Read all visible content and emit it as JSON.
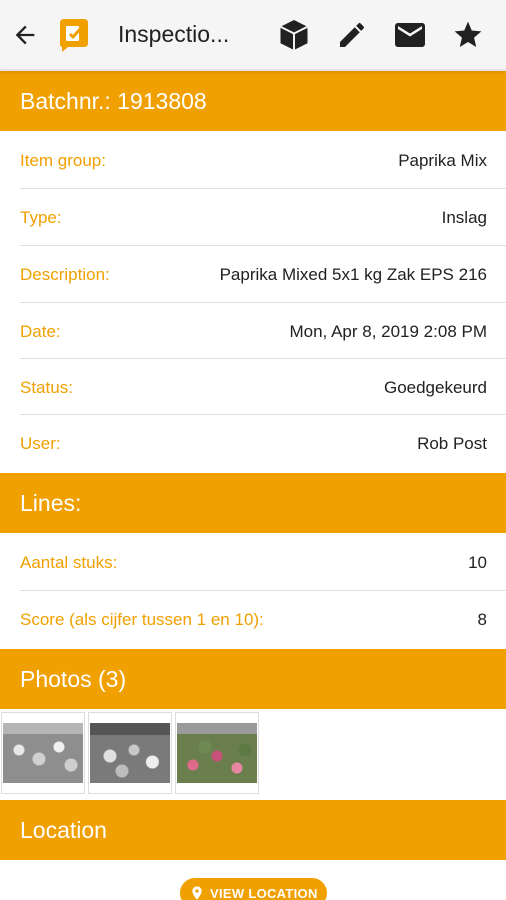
{
  "appbar": {
    "title": "Inspectio...",
    "back_icon": "arrow-left-icon",
    "logo_icon": "app-logo-icon",
    "actions": [
      "cube-icon",
      "pencil-icon",
      "mail-icon",
      "star-icon"
    ]
  },
  "batch_header": "Batchnr.: 1913808",
  "details": [
    {
      "label": "Item group:",
      "value": "Paprika Mix"
    },
    {
      "label": "Type:",
      "value": "Inslag"
    },
    {
      "label": "Description:",
      "value": "Paprika Mixed 5x1 kg Zak EPS 216"
    },
    {
      "label": "Date:",
      "value": "Mon, Apr 8, 2019 2:08 PM"
    },
    {
      "label": "Status:",
      "value": "Goedgekeurd"
    },
    {
      "label": "User:",
      "value": "Rob Post"
    }
  ],
  "lines_header": "Lines:",
  "lines": [
    {
      "label": "Aantal stuks:",
      "value": "10"
    },
    {
      "label": "Score (als cijfer tussen 1 en 10):",
      "value": "8"
    }
  ],
  "photos_header": "Photos (3)",
  "location_header": "Location",
  "view_location_label": "VIEW LOCATION",
  "colors": {
    "accent": "#f0a000",
    "appbar": "#f5f5f5"
  }
}
